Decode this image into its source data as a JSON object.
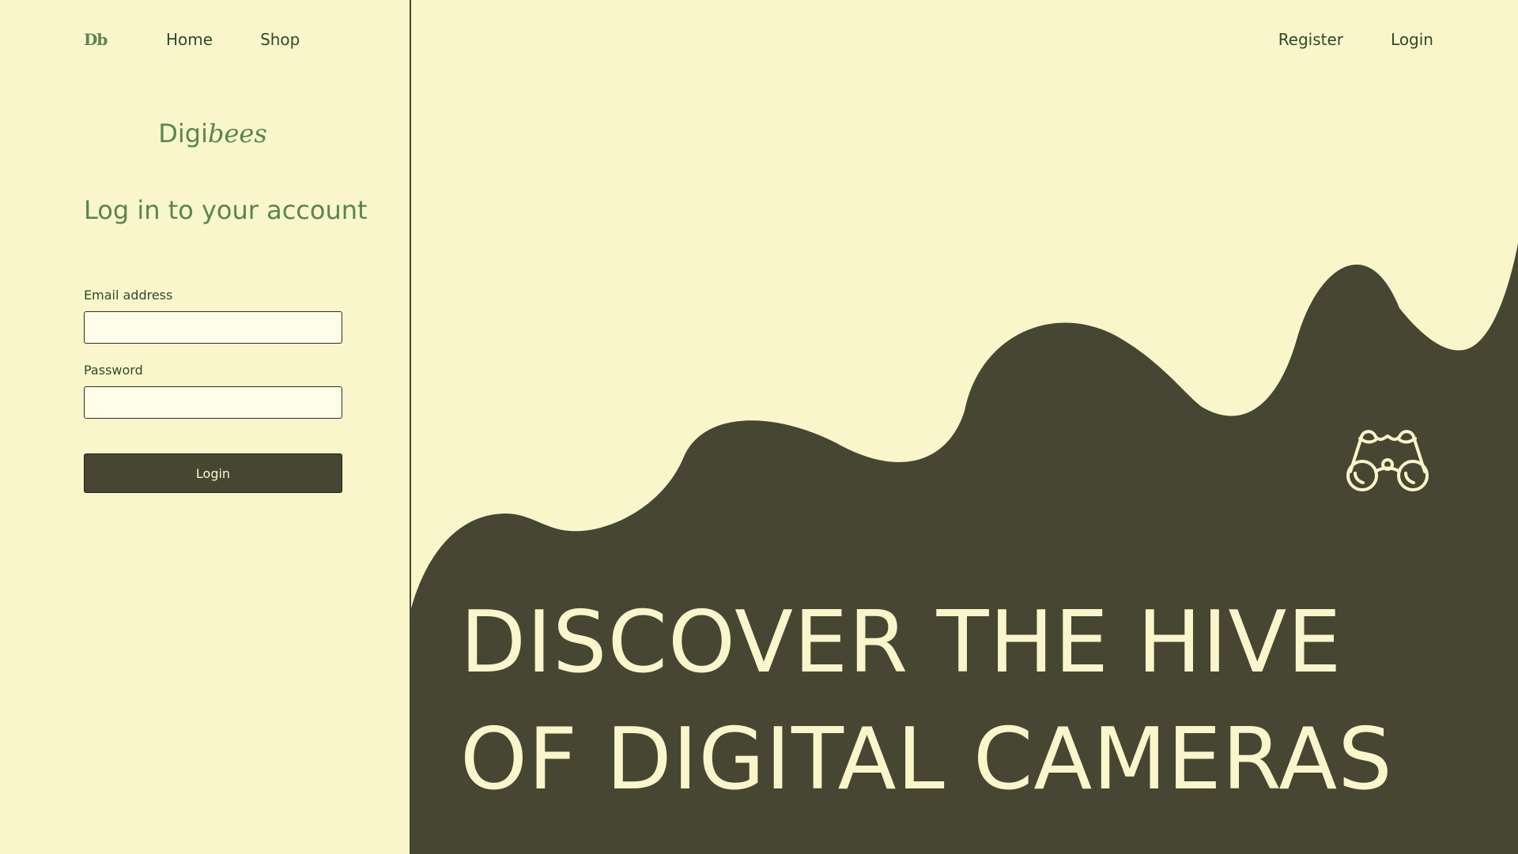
{
  "colors": {
    "background": "#f9f6cb",
    "dark": "#474632",
    "green": "#5a8550",
    "nav_text": "#2d4a2b",
    "input_bg": "#fefee8"
  },
  "nav": {
    "logo_mark": "Db",
    "left_links": [
      "Home",
      "Shop"
    ],
    "right_links": [
      "Register",
      "Login"
    ]
  },
  "brand": {
    "part1": "Digi",
    "part2": "bees"
  },
  "login_form": {
    "title": "Log in to your account",
    "email_label": "Email address",
    "email_value": "",
    "password_label": "Password",
    "password_value": "",
    "submit_label": "Login"
  },
  "hero": {
    "line1": "DISCOVER THE HIVE",
    "line2": "OF DIGITAL CAMERAS",
    "icon": "binoculars-icon"
  }
}
